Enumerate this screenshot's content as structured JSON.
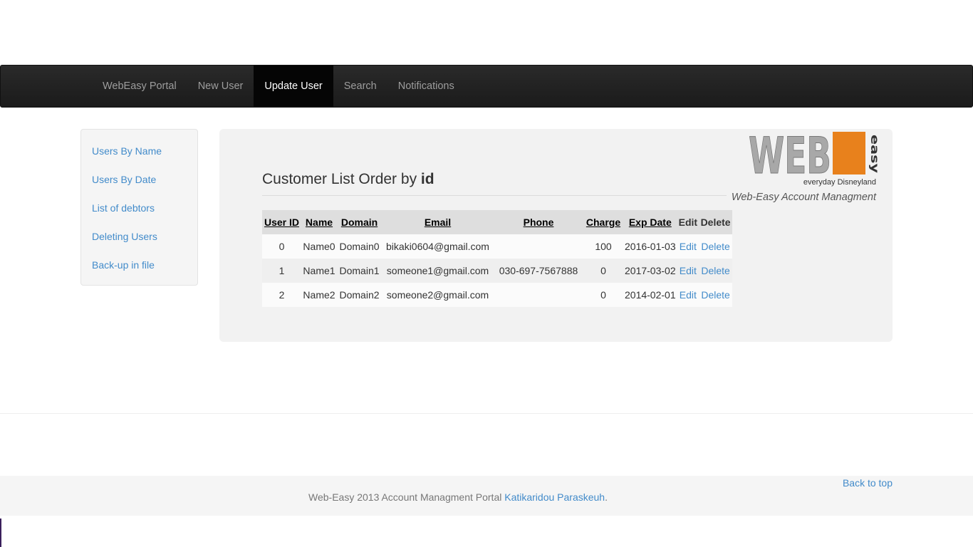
{
  "nav": {
    "items": [
      {
        "label": "WebEasy Portal"
      },
      {
        "label": "New User"
      },
      {
        "label": "Update User"
      },
      {
        "label": "Search"
      },
      {
        "label": "Notifications"
      }
    ]
  },
  "sidebar": {
    "items": [
      {
        "label": "Users By Name"
      },
      {
        "label": "Users By Date"
      },
      {
        "label": "List of debtors"
      },
      {
        "label": "Deleting Users"
      },
      {
        "label": "Back-up in file"
      }
    ]
  },
  "logo": {
    "text": "WEB",
    "badge": "easy",
    "tagline": "everyday Disneyland",
    "caption": "Web-Easy Account Managment"
  },
  "main": {
    "title_prefix": "Customer List Order by",
    "title_key": "id"
  },
  "table": {
    "headers": {
      "user_id": "User ID",
      "name": "Name",
      "domain": "Domain",
      "email": "Email",
      "phone": "Phone",
      "charge": "Charge",
      "exp_date": "Exp Date",
      "edit": "Edit",
      "delete": "Delete"
    },
    "rows": [
      {
        "user_id": "0",
        "name": "Name0",
        "domain": "Domain0",
        "email": "bikaki0604@gmail.com",
        "phone": "",
        "charge": "100",
        "exp_date": "2016-01-03",
        "edit": "Edit",
        "delete": "Delete"
      },
      {
        "user_id": "1",
        "name": "Name1",
        "domain": "Domain1",
        "email": "someone1@gmail.com",
        "phone": "030-697-7567888",
        "charge": "0",
        "exp_date": "2017-03-02",
        "edit": "Edit",
        "delete": "Delete"
      },
      {
        "user_id": "2",
        "name": "Name2",
        "domain": "Domain2",
        "email": "someone2@gmail.com",
        "phone": "",
        "charge": "0",
        "exp_date": "2014-02-01",
        "edit": "Edit",
        "delete": "Delete"
      }
    ]
  },
  "footer": {
    "back_to_top": "Back to top",
    "text": "Web-Easy 2013 Account Managment Portal",
    "author": "Katikaridou Paraskeuh",
    "period": "."
  },
  "colors": {
    "navbar": "#222222",
    "link": "#428bca",
    "logo_orange": "#e8811c",
    "logo_gray": "#a8a8a8"
  }
}
